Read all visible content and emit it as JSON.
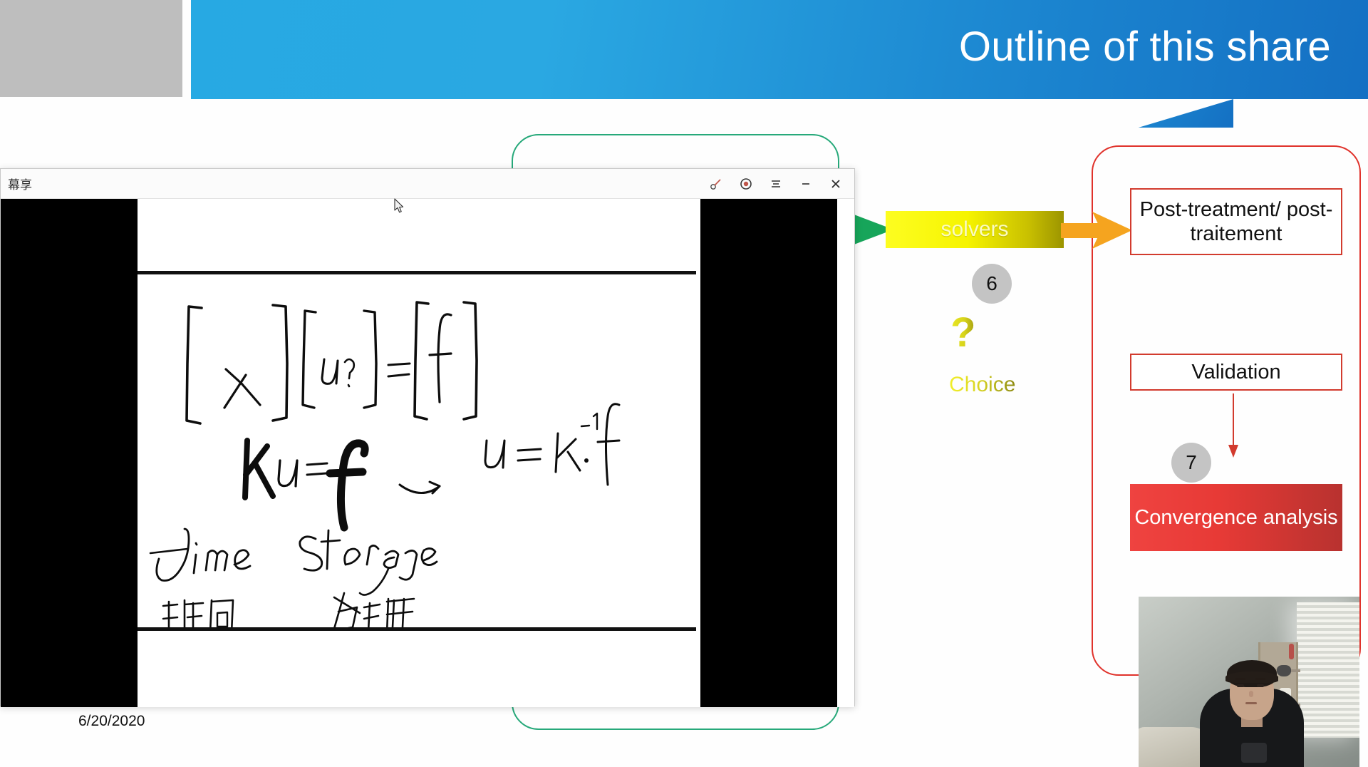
{
  "slide": {
    "title": "Outline of this share",
    "date": "6/20/2020",
    "flow": {
      "solvers_label": "solvers",
      "step_6": "6",
      "question_mark": "?",
      "choice_label": "Choice",
      "post_treatment": "Post-treatment/ post-traitement",
      "validation": "Validation",
      "step_7": "7",
      "convergence": "Convergence analysis"
    },
    "colors": {
      "banner_blue": "#1b84cf",
      "solvers_yellow": "#f6f400",
      "arrow_orange": "#f5a41f",
      "arrow_green": "#17a55a",
      "outline_red": "#d23b2e",
      "convergence_red": "#e73a36",
      "circle_gray": "#c4c4c4",
      "group_blue": "#2e75b6",
      "group_green": "#27a97a"
    }
  },
  "share_window": {
    "title": "幕享",
    "controls": [
      {
        "name": "annotate",
        "icon": "pen-icon"
      },
      {
        "name": "record",
        "icon": "record-icon"
      },
      {
        "name": "menu",
        "icon": "menu-icon"
      },
      {
        "name": "minimize",
        "icon": "minimize-icon"
      },
      {
        "name": "close",
        "icon": "close-icon"
      }
    ],
    "whiteboard": {
      "matrix_equation": "[ K ] [ u? ] = [ f ]",
      "scalar_equation": "ku = f",
      "implies_arrow": "→",
      "solution": "u = k⁻¹·f",
      "note_time_en": "time",
      "note_time_zh": "时间",
      "note_storage_en": "Storage",
      "note_storage_zh": "存储"
    }
  },
  "webcam": {
    "label": "presenter-video-feed"
  }
}
